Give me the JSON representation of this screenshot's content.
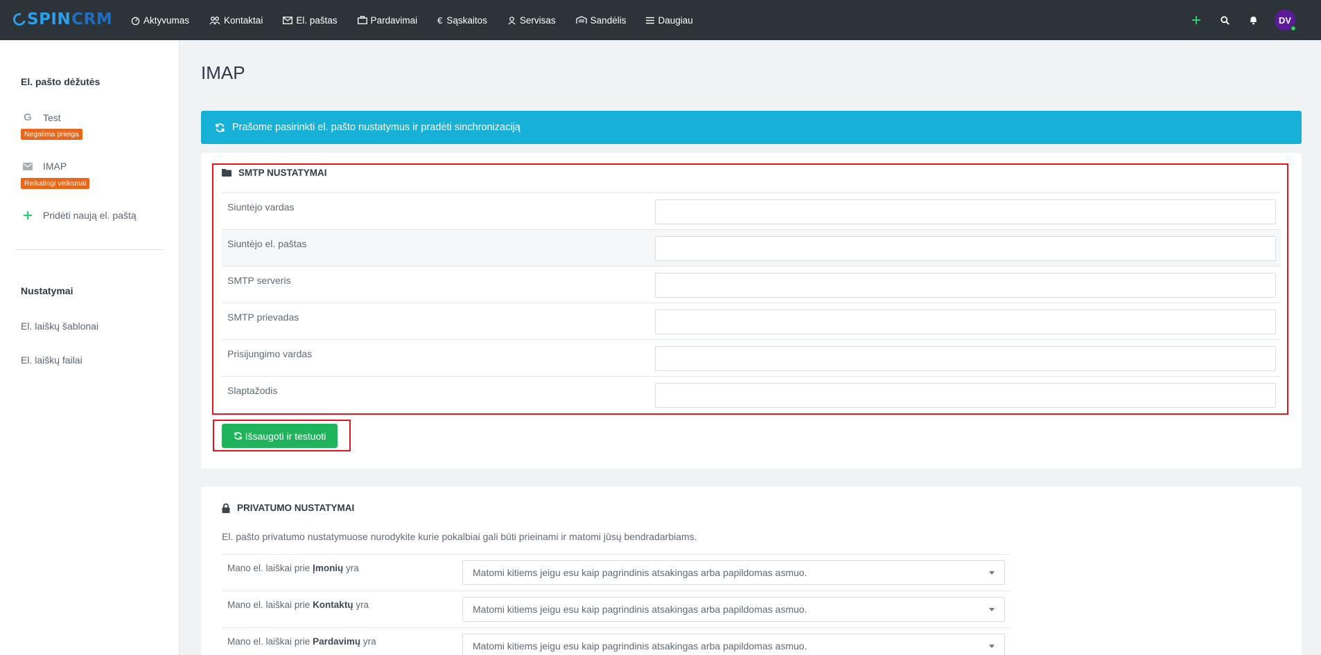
{
  "app": {
    "logo_spin": "SPIN",
    "logo_crm": "CRM"
  },
  "nav": {
    "items": [
      {
        "label": "Aktyvumas",
        "icon": "dashboard-icon"
      },
      {
        "label": "Kontaktai",
        "icon": "users-icon"
      },
      {
        "label": "El. paštas",
        "icon": "envelope-icon"
      },
      {
        "label": "Pardavimai",
        "icon": "briefcase-icon"
      },
      {
        "label": "Sąskaitos",
        "icon": "euro-icon"
      },
      {
        "label": "Servisas",
        "icon": "support-icon"
      },
      {
        "label": "Sandėlis",
        "icon": "warehouse-icon"
      },
      {
        "label": "Daugiau",
        "icon": "menu-icon"
      }
    ],
    "user_initials": "DV"
  },
  "sidebar": {
    "mailboxes_heading": "El. pašto dėžutės",
    "mailboxes": [
      {
        "label": "Test",
        "badge": "Negalima prieiga",
        "icon": "google-icon"
      },
      {
        "label": "IMAP",
        "badge": "Reikalingi veiksmai",
        "icon": "envelope-icon"
      }
    ],
    "add_label": "Pridėti naują el. paštą",
    "settings_heading": "Nustatymai",
    "links": [
      "El. laiškų šablonai",
      "El. laiškų failai"
    ]
  },
  "page": {
    "title": "IMAP",
    "alert": "Prašome pasirinkti el. pašto nustatymus ir pradėti sinchronizaciją"
  },
  "smtp": {
    "title": "SMTP NUSTATYMAI",
    "fields": [
      {
        "label": "Siuntėjo vardas",
        "value": ""
      },
      {
        "label": "Siuntėjo el. paštas",
        "value": ""
      },
      {
        "label": "SMTP serveris",
        "value": ""
      },
      {
        "label": "SMTP prievadas",
        "value": ""
      },
      {
        "label": "Prisijungimo vardas",
        "value": ""
      },
      {
        "label": "Slaptažodis",
        "value": ""
      }
    ],
    "save_button": "Išsaugoti ir testuoti"
  },
  "privacy": {
    "title": "PRIVATUMO NUSTATYMAI",
    "description": "El. pašto privatumo nustatymuose nurodykite kurie pokalbiai gali būti prieinami ir matomi jūsų bendradarbiams.",
    "rows": [
      {
        "prefix": "Mano el. laiškai prie ",
        "entity": "Įmonių",
        "suffix": " yra",
        "value": "Matomi kitiems jeigu esu kaip pagrindinis atsakingas arba papildomas asmuo."
      },
      {
        "prefix": "Mano el. laiškai prie ",
        "entity": "Kontaktų",
        "suffix": " yra",
        "value": "Matomi kitiems jeigu esu kaip pagrindinis atsakingas arba papildomas asmuo."
      },
      {
        "prefix": "Mano el. laiškai prie ",
        "entity": "Pardavimų",
        "suffix": " yra",
        "value": "Matomi kitiems jeigu esu kaip pagrindinis atsakingas arba papildomas asmuo."
      }
    ]
  },
  "colors": {
    "topbar": "#2c3339",
    "alert": "#17b0d6",
    "save": "#1fb35b",
    "badge": "#ea6618",
    "highlight": "#e3151c"
  }
}
